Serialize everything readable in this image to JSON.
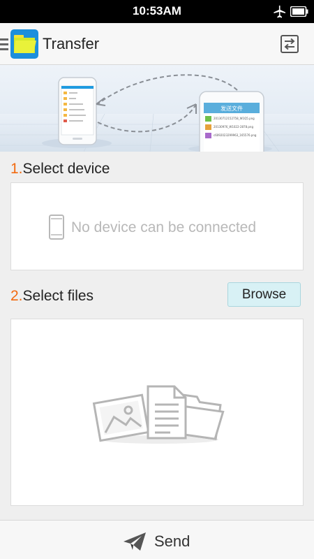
{
  "status_bar": {
    "time": "10:53AM",
    "icons": [
      "airplane-icon",
      "battery-icon"
    ]
  },
  "app_bar": {
    "title": "Transfer",
    "icons": [
      "menu-icon",
      "app-logo",
      "switch-icon"
    ]
  },
  "banner": {
    "screen_title": "发送文件",
    "files": [
      "20130712152758_W1Q5.png",
      "20130976_W1022-2878.png",
      "c6092023299963_165576.png"
    ]
  },
  "section1": {
    "number": "1.",
    "label": "Select device",
    "empty_message": "No device can be connected"
  },
  "section2": {
    "number": "2.",
    "label": "Select files",
    "browse_label": "Browse"
  },
  "bottom_bar": {
    "send_label": "Send"
  },
  "colors": {
    "accent": "#f26a10",
    "browse_bg": "#d8f1f5",
    "banner_header": "#5aaedc"
  }
}
